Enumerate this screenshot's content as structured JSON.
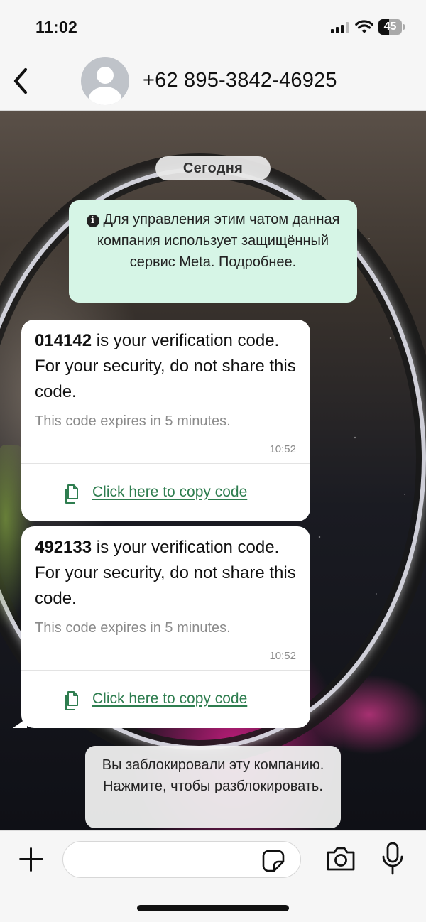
{
  "status_bar": {
    "time": "11:02",
    "battery": "45",
    "battery_level": 0.45
  },
  "header": {
    "back_icon": "chevron-left-icon",
    "contact_name": "+62 895-3842-46925"
  },
  "chat": {
    "date_label": "Сегодня",
    "business_notice": "Для управления этим чатом данная компания использует защищённый сервис Meta. Подробнее.",
    "messages": [
      {
        "code": "014142",
        "text": " is your verification code. For your security, do not share this code.",
        "footer": "This code expires in 5 minutes.",
        "time": "10:52",
        "copy_label": "Click here to copy code"
      },
      {
        "code": "492133",
        "text": " is your verification code. For your security, do not share this code.",
        "footer": "This code expires in 5 minutes.",
        "time": "10:52",
        "copy_label": "Click here to copy code"
      }
    ],
    "blocked_notice": "Вы заблокировали эту компанию. Нажмите, чтобы разблокировать."
  },
  "input_bar": {
    "message_value": "",
    "icons": [
      "plus-icon",
      "sticker-icon",
      "camera-icon",
      "microphone-icon"
    ]
  },
  "colors": {
    "notice_bg": "#d6f5e6",
    "link": "#2e7d4f"
  }
}
